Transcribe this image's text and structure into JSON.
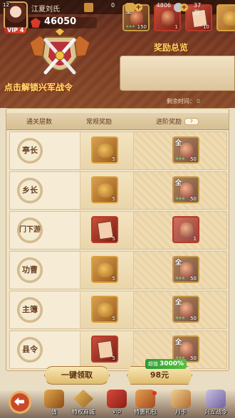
{
  "header": {
    "player_level": "12",
    "player_name": "江夏刘氏",
    "vip_label": "VIP 4",
    "resources": [
      {
        "icon": "scroll-icon",
        "value": "0"
      },
      {
        "icon": "gold-ingot-icon",
        "value": "4806"
      },
      {
        "icon": "silver-coin-icon",
        "value": "37万"
      }
    ],
    "power": "46050",
    "unlock_text": "点击解锁兴军战令",
    "rewards_overview_title": "奖励总览",
    "rewards_overview": [
      {
        "icon": "treasure-jar-icon",
        "all_tag": "全",
        "count": "150",
        "stars": "★★★"
      },
      {
        "icon": "red-chest-icon",
        "count": "1"
      },
      {
        "icon": "red-book-icon",
        "count": "10"
      },
      {
        "icon": "bag-icon",
        "count": ""
      }
    ],
    "remaining_label": "剩余时间：",
    "remaining_value": "0"
  },
  "table": {
    "columns": [
      "通关层数",
      "常规奖励",
      "进阶奖励"
    ],
    "help_label": "?",
    "rows": [
      {
        "rank": "亭长",
        "normal": {
          "type": "gold-bag",
          "count": "5"
        },
        "advanced": {
          "all_tag": "全",
          "stars": "★★★",
          "count": "50"
        }
      },
      {
        "rank": "乡长",
        "normal": {
          "type": "gold-bag",
          "count": "5"
        },
        "advanced": {
          "all_tag": "全",
          "stars": "★★★",
          "count": "50"
        }
      },
      {
        "rank": "门下游",
        "normal": {
          "type": "red-book",
          "count": "5"
        },
        "advanced": {
          "all_tag": "",
          "stars": "",
          "count": "1"
        }
      },
      {
        "rank": "功曹",
        "normal": {
          "type": "gold-bag",
          "count": "5"
        },
        "advanced": {
          "all_tag": "全",
          "stars": "★★★",
          "count": "50"
        }
      },
      {
        "rank": "主簿",
        "normal": {
          "type": "gold-bag",
          "count": "5"
        },
        "advanced": {
          "all_tag": "全",
          "stars": "★★★",
          "count": "50"
        }
      },
      {
        "rank": "县令",
        "normal": {
          "type": "red-book",
          "count": "5"
        },
        "advanced": {
          "all_tag": "全",
          "stars": "★★★",
          "count": "50"
        }
      }
    ]
  },
  "actions": {
    "claim_all": "一键领取",
    "value_badge_prefix": "超值",
    "value_badge": "3000%",
    "price": "98元"
  },
  "dock": {
    "items": [
      {
        "label": "值",
        "icon": "value-icon"
      },
      {
        "label": "特权商城",
        "icon": "privilege-shop-icon"
      },
      {
        "label": "vip",
        "icon": "vip-icon"
      },
      {
        "label": "特惠礼包",
        "icon": "gift-pack-icon"
      },
      {
        "label": "月卡",
        "icon": "monthly-card-icon"
      },
      {
        "label": "兴军战令",
        "icon": "battle-pass-icon"
      }
    ]
  }
}
